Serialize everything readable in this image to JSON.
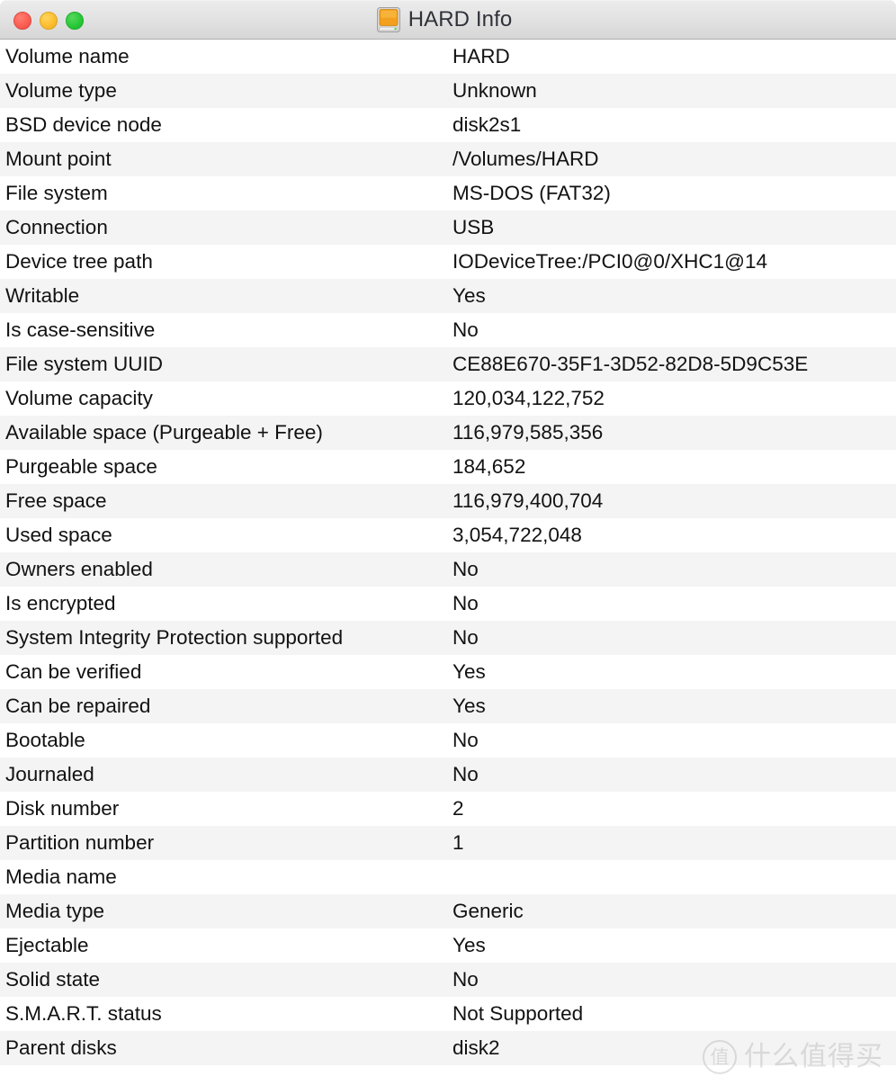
{
  "window": {
    "title": "HARD Info",
    "icon": "external-drive-icon",
    "controls": {
      "close_label": "Close",
      "minimize_label": "Minimize",
      "maximize_label": "Zoom"
    },
    "colors": {
      "close": "#fb5f54",
      "minimize": "#fcbe31",
      "maximize": "#2ac93a",
      "titlebar_top": "#ececec",
      "titlebar_bottom": "#d6d6d6",
      "row_alt": "#f4f4f4",
      "text": "#121212",
      "drive_face": "#f2a01e"
    }
  },
  "info": {
    "rows": [
      {
        "label": "Volume name",
        "value": "HARD"
      },
      {
        "label": "Volume type",
        "value": "Unknown"
      },
      {
        "label": "BSD device node",
        "value": "disk2s1"
      },
      {
        "label": "Mount point",
        "value": "/Volumes/HARD"
      },
      {
        "label": "File system",
        "value": "MS-DOS (FAT32)"
      },
      {
        "label": "Connection",
        "value": "USB"
      },
      {
        "label": "Device tree path",
        "value": "IODeviceTree:/PCI0@0/XHC1@14"
      },
      {
        "label": "Writable",
        "value": "Yes"
      },
      {
        "label": "Is case-sensitive",
        "value": "No"
      },
      {
        "label": "File system UUID",
        "value": "CE88E670-35F1-3D52-82D8-5D9C53E"
      },
      {
        "label": "Volume capacity",
        "value": "120,034,122,752"
      },
      {
        "label": "Available space (Purgeable + Free)",
        "value": "116,979,585,356"
      },
      {
        "label": "Purgeable space",
        "value": "184,652"
      },
      {
        "label": "Free space",
        "value": "116,979,400,704"
      },
      {
        "label": "Used space",
        "value": "3,054,722,048"
      },
      {
        "label": "Owners enabled",
        "value": "No"
      },
      {
        "label": "Is encrypted",
        "value": "No"
      },
      {
        "label": "System Integrity Protection supported",
        "value": "No"
      },
      {
        "label": "Can be verified",
        "value": "Yes"
      },
      {
        "label": "Can be repaired",
        "value": "Yes"
      },
      {
        "label": "Bootable",
        "value": "No"
      },
      {
        "label": "Journaled",
        "value": "No"
      },
      {
        "label": "Disk number",
        "value": "2"
      },
      {
        "label": "Partition number",
        "value": "1"
      },
      {
        "label": "Media name",
        "value": ""
      },
      {
        "label": "Media type",
        "value": "Generic"
      },
      {
        "label": "Ejectable",
        "value": "Yes"
      },
      {
        "label": "Solid state",
        "value": "No"
      },
      {
        "label": "S.M.A.R.T. status",
        "value": "Not Supported"
      },
      {
        "label": "Parent disks",
        "value": "disk2"
      }
    ]
  },
  "watermark": {
    "badge": "值",
    "text": "什么值得买"
  }
}
